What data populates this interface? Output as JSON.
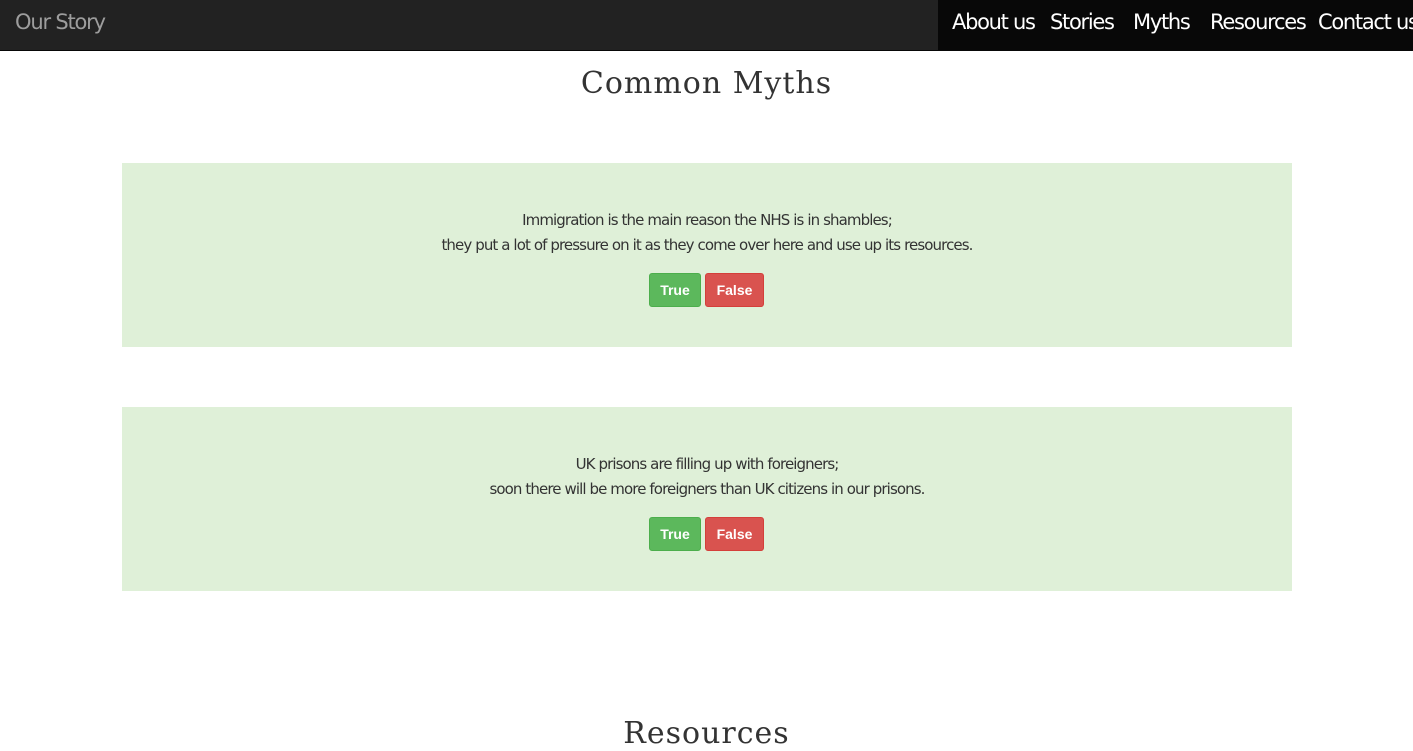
{
  "navbar": {
    "brand": "Our Story",
    "links": [
      {
        "label": "About us"
      },
      {
        "label": "Stories"
      },
      {
        "label": "Myths"
      },
      {
        "label": "Resources"
      },
      {
        "label": "Contact us"
      }
    ]
  },
  "main": {
    "title": "Common Myths",
    "myths": [
      {
        "line1": "Immigration is the main reason the NHS is in shambles;",
        "line2": "they put a lot of pressure on it as they come over here and use up its resources.",
        "true_label": "True",
        "false_label": "False"
      },
      {
        "line1": "UK prisons are filling up with foreigners;",
        "line2": "soon there will be more foreigners than UK citizens in our prisons.",
        "true_label": "True",
        "false_label": "False"
      }
    ],
    "next_section_title": "Resources"
  },
  "colors": {
    "navbar_bg": "#222222",
    "navbar_active_bg": "#080808",
    "card_bg": "#dff0d8",
    "true_button": "#5cb85c",
    "false_button": "#d9534f"
  }
}
